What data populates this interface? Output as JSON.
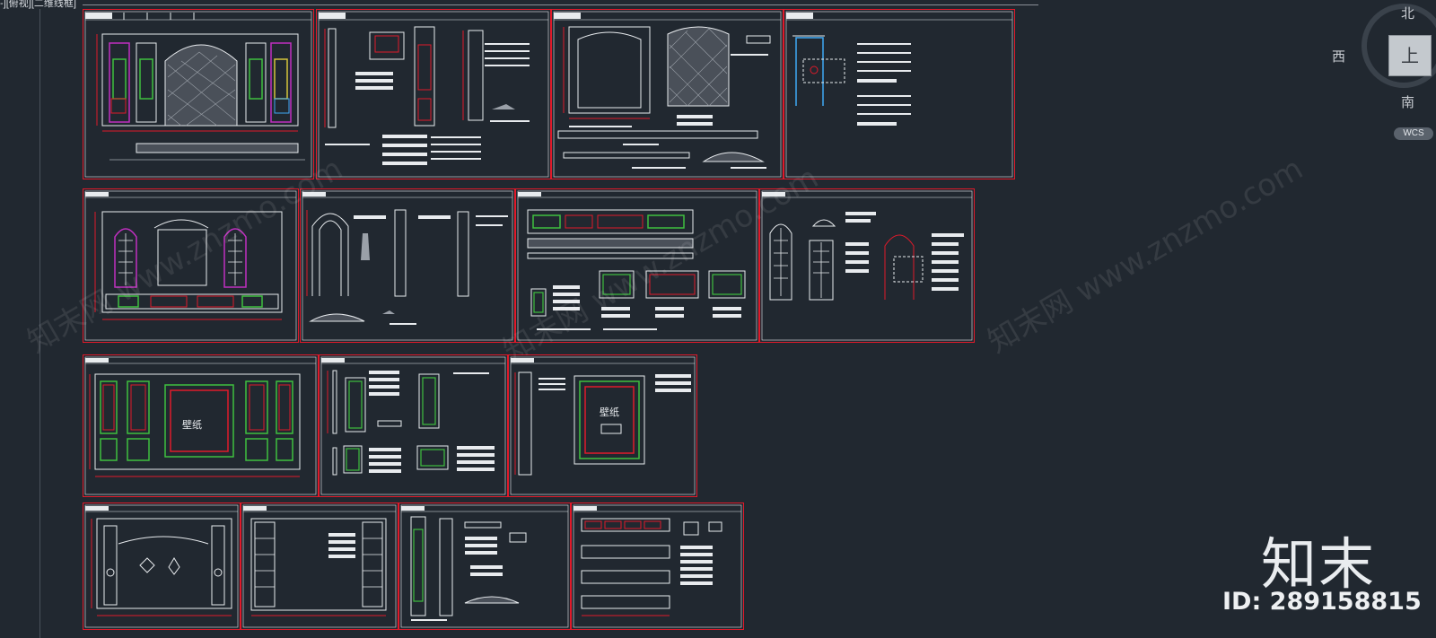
{
  "viewport": {
    "label": "-][俯视][二维线框]"
  },
  "viewcube": {
    "north": "北",
    "west": "西",
    "south": "南",
    "face": "上",
    "wcs": "WCS"
  },
  "drawing": {
    "wallpaper_label": "壁纸"
  },
  "watermark": {
    "text": "知末网 www.znzmo.com"
  },
  "brand": {
    "logo": "知末",
    "id": "ID: 289158815"
  },
  "colors": {
    "background": "#212830",
    "frame": "#e01a2a",
    "line": "#e8ebee",
    "green": "#3fbf3f",
    "magenta": "#c02fc0",
    "yellow": "#d6c63a",
    "cyan": "#3fa9f5"
  },
  "sheets": [
    {
      "id": "row1-a",
      "kind": "arch-elevation"
    },
    {
      "id": "row1-b",
      "kind": "details"
    },
    {
      "id": "row1-c",
      "kind": "arch-details"
    },
    {
      "id": "row1-d",
      "kind": "section-notes"
    },
    {
      "id": "row2-a",
      "kind": "window-elevation"
    },
    {
      "id": "row2-b",
      "kind": "column-details"
    },
    {
      "id": "row2-c",
      "kind": "panel-details"
    },
    {
      "id": "row2-d",
      "kind": "window-details"
    },
    {
      "id": "row3-a",
      "kind": "wallpaper-elevation"
    },
    {
      "id": "row3-b",
      "kind": "panel-sections"
    },
    {
      "id": "row3-c",
      "kind": "wallpaper-detail"
    },
    {
      "id": "row4-a",
      "kind": "frame-elevation"
    },
    {
      "id": "row4-b",
      "kind": "shelf-elevation"
    },
    {
      "id": "row4-c",
      "kind": "column-sections"
    },
    {
      "id": "row4-d",
      "kind": "cabinet-details"
    }
  ]
}
